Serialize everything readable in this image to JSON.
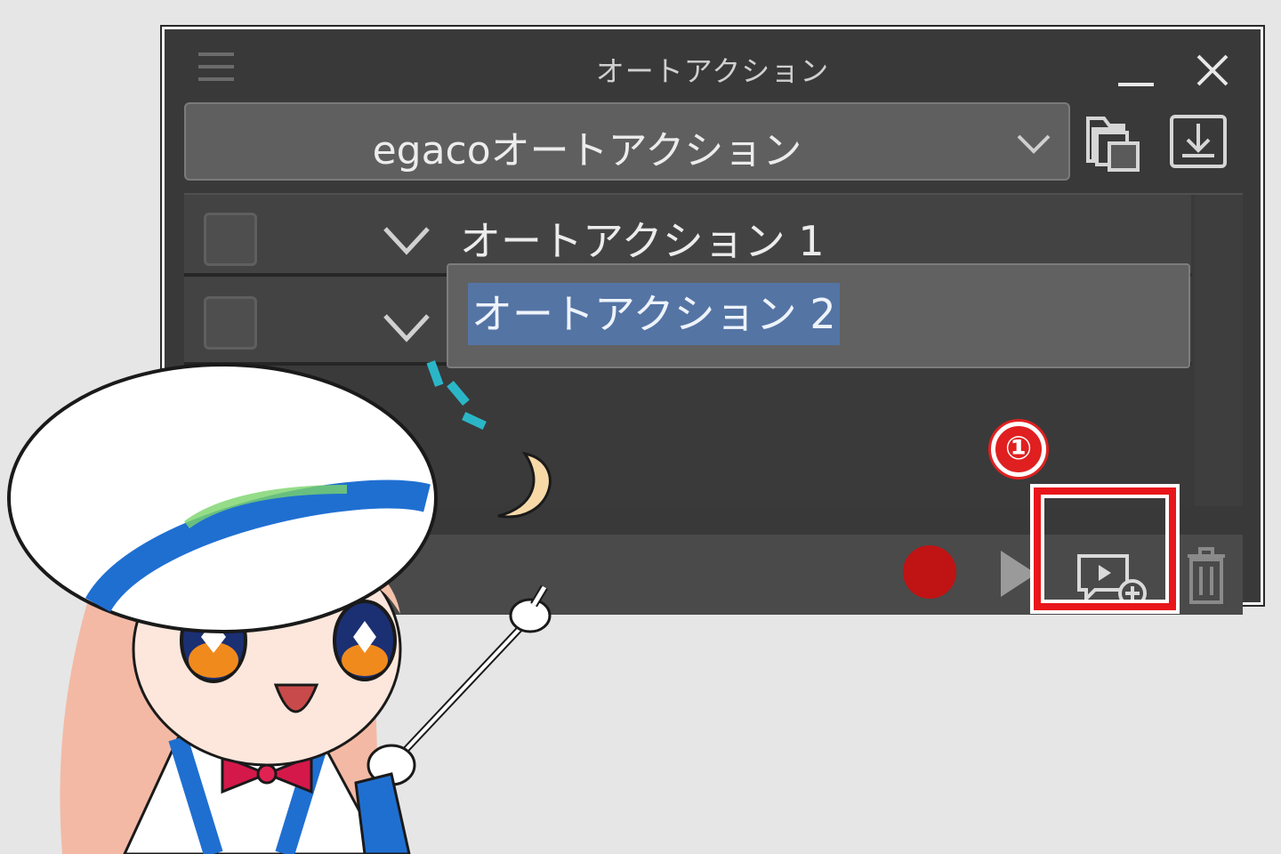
{
  "panel": {
    "title": "オートアクション",
    "set_selector": {
      "value": "egacoオートアクション"
    },
    "items": [
      {
        "label": "オートアクション 1"
      },
      {
        "label": ""
      }
    ],
    "rename_field": {
      "value": "オートアクション 2"
    },
    "bottom_toolbar": {
      "icons": [
        "record-icon",
        "play-icon",
        "add-command-icon",
        "trash-icon"
      ]
    }
  },
  "callout": {
    "step_number": "①",
    "highlight_color": "#e8161b"
  },
  "colors": {
    "panel_bg": "#393939",
    "record": "#c01313",
    "selection": "#5474a4"
  }
}
